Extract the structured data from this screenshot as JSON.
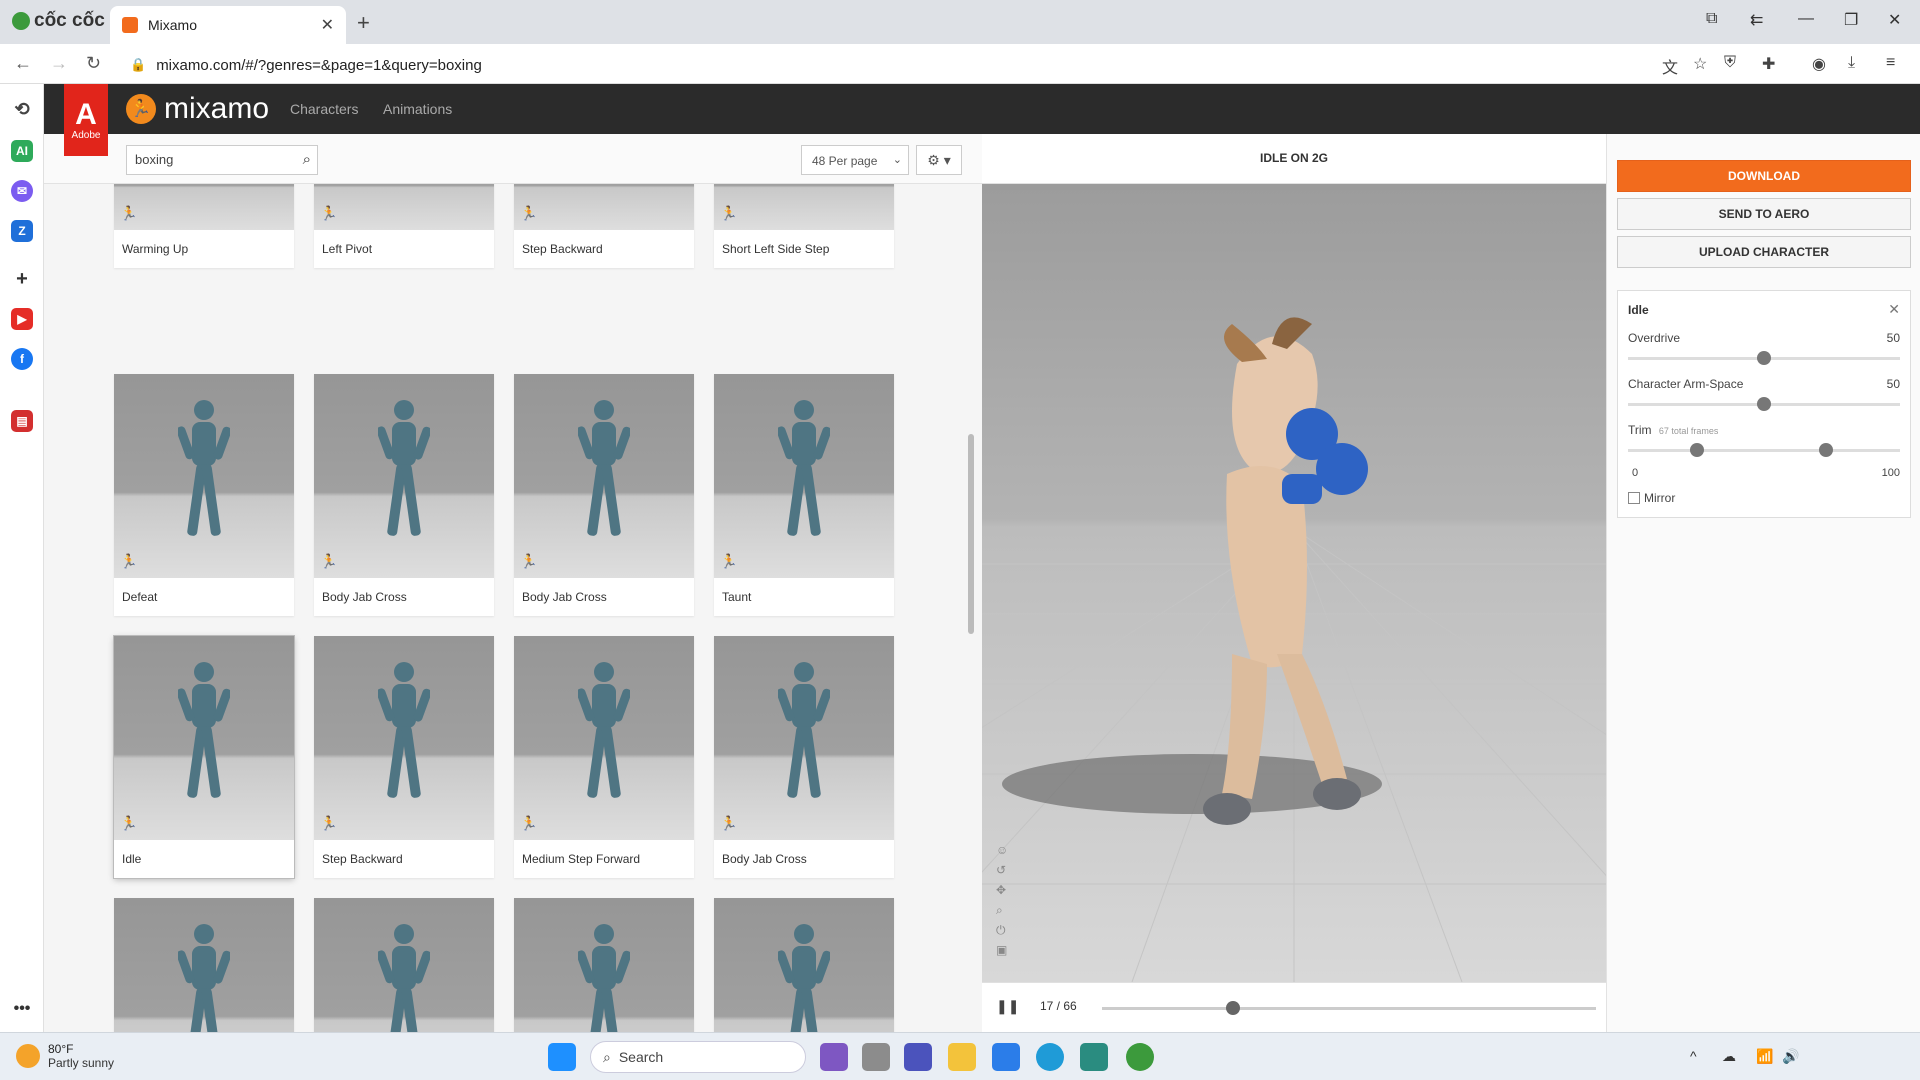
{
  "browser": {
    "brand": "cốc cốc",
    "tab_title": "Mixamo",
    "url": "mixamo.com/#/?genres=&page=1&query=boxing"
  },
  "mixamo": {
    "adobe_label": "Adobe",
    "logo_text": "mixamo",
    "nav": [
      "Characters",
      "Animations"
    ]
  },
  "toolbar": {
    "search_value": "boxing",
    "per_page": "48 Per page"
  },
  "cards": [
    {
      "label": "Warming Up"
    },
    {
      "label": "Left Pivot"
    },
    {
      "label": "Step Backward"
    },
    {
      "label": "Short Left Side Step"
    },
    {
      "label": "Defeat"
    },
    {
      "label": "Body Jab Cross"
    },
    {
      "label": "Body Jab Cross"
    },
    {
      "label": "Taunt"
    },
    {
      "label": "Idle"
    },
    {
      "label": "Step Backward"
    },
    {
      "label": "Medium Step Forward"
    },
    {
      "label": "Body Jab Cross"
    },
    {
      "label": ""
    },
    {
      "label": ""
    },
    {
      "label": ""
    },
    {
      "label": ""
    }
  ],
  "viewer": {
    "title": "IDLE ON 2G",
    "frame_current": "17",
    "frame_total": "66",
    "frame_display": "17 / 66"
  },
  "actions": {
    "download": "DOWNLOAD",
    "send_to_aero": "SEND TO AERO",
    "upload_character": "UPLOAD CHARACTER"
  },
  "settings": {
    "title": "Idle",
    "overdrive_label": "Overdrive",
    "overdrive_value": "50",
    "armspace_label": "Character Arm-Space",
    "armspace_value": "50",
    "trim_label": "Trim",
    "trim_sub": "67 total frames",
    "trim_min": "0",
    "trim_max": "100",
    "mirror_label": "Mirror"
  },
  "taskbar": {
    "temp": "80°F",
    "weather": "Partly sunny",
    "search": "Search"
  },
  "colors": {
    "accent": "#f26b1d",
    "adobe_red": "#e1251b",
    "header": "#2b2b2b"
  }
}
